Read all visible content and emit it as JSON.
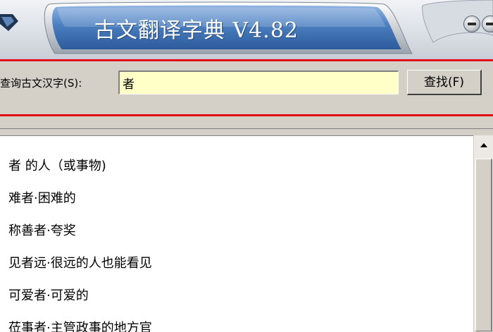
{
  "window": {
    "title": "古文翻译字典 V4.82"
  },
  "search": {
    "label": "查询古文汉字(S):",
    "value": "者",
    "button_label": "查找(F)"
  },
  "results": [
    "者 的人（或事物)",
    "难者·困难的",
    "称善者·夸奖",
    "见者远·很远的人也能看见",
    "可爱者·可爱的",
    "莅事者·主管政事的地方官"
  ],
  "colors": {
    "accent_red": "#e01010",
    "input_background": "#ffffc8",
    "title_banner_blue": "#4a7fc0"
  }
}
